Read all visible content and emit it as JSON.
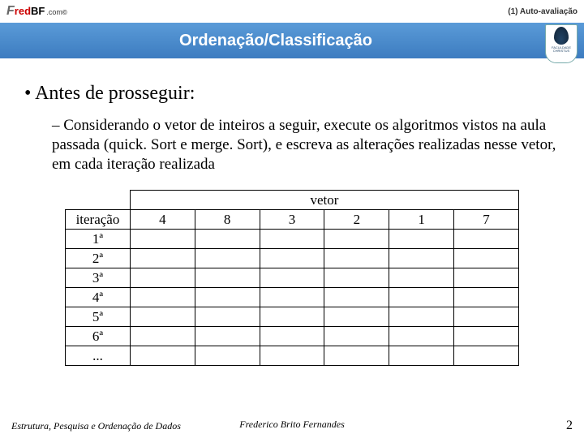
{
  "header": {
    "logo_f": "F",
    "logo_red": "red",
    "logo_bf": "BF",
    "logo_com": ".com",
    "logo_reg": "©",
    "top_right": "(1) Auto-avaliação",
    "title": "Ordenação/Classificação",
    "crest_label": "FACULDADE CHRISTUS"
  },
  "body": {
    "bullet1": "•  Antes de prosseguir:",
    "bullet2": "–  Considerando o vetor de inteiros a seguir, execute os algoritmos vistos na aula passada (quick. Sort e merge. Sort), e escreva as alterações realizadas nesse vetor, em cada iteração realizada"
  },
  "table": {
    "vetor": "vetor",
    "iter_label": "iteração",
    "values": [
      "4",
      "8",
      "3",
      "2",
      "1",
      "7"
    ],
    "rows": [
      "1ª",
      "2ª",
      "3ª",
      "4ª",
      "5ª",
      "6ª",
      "..."
    ]
  },
  "footer": {
    "left": "Estrutura, Pesquisa e Ordenação de Dados",
    "center": "Frederico Brito Fernandes",
    "page": "2"
  }
}
